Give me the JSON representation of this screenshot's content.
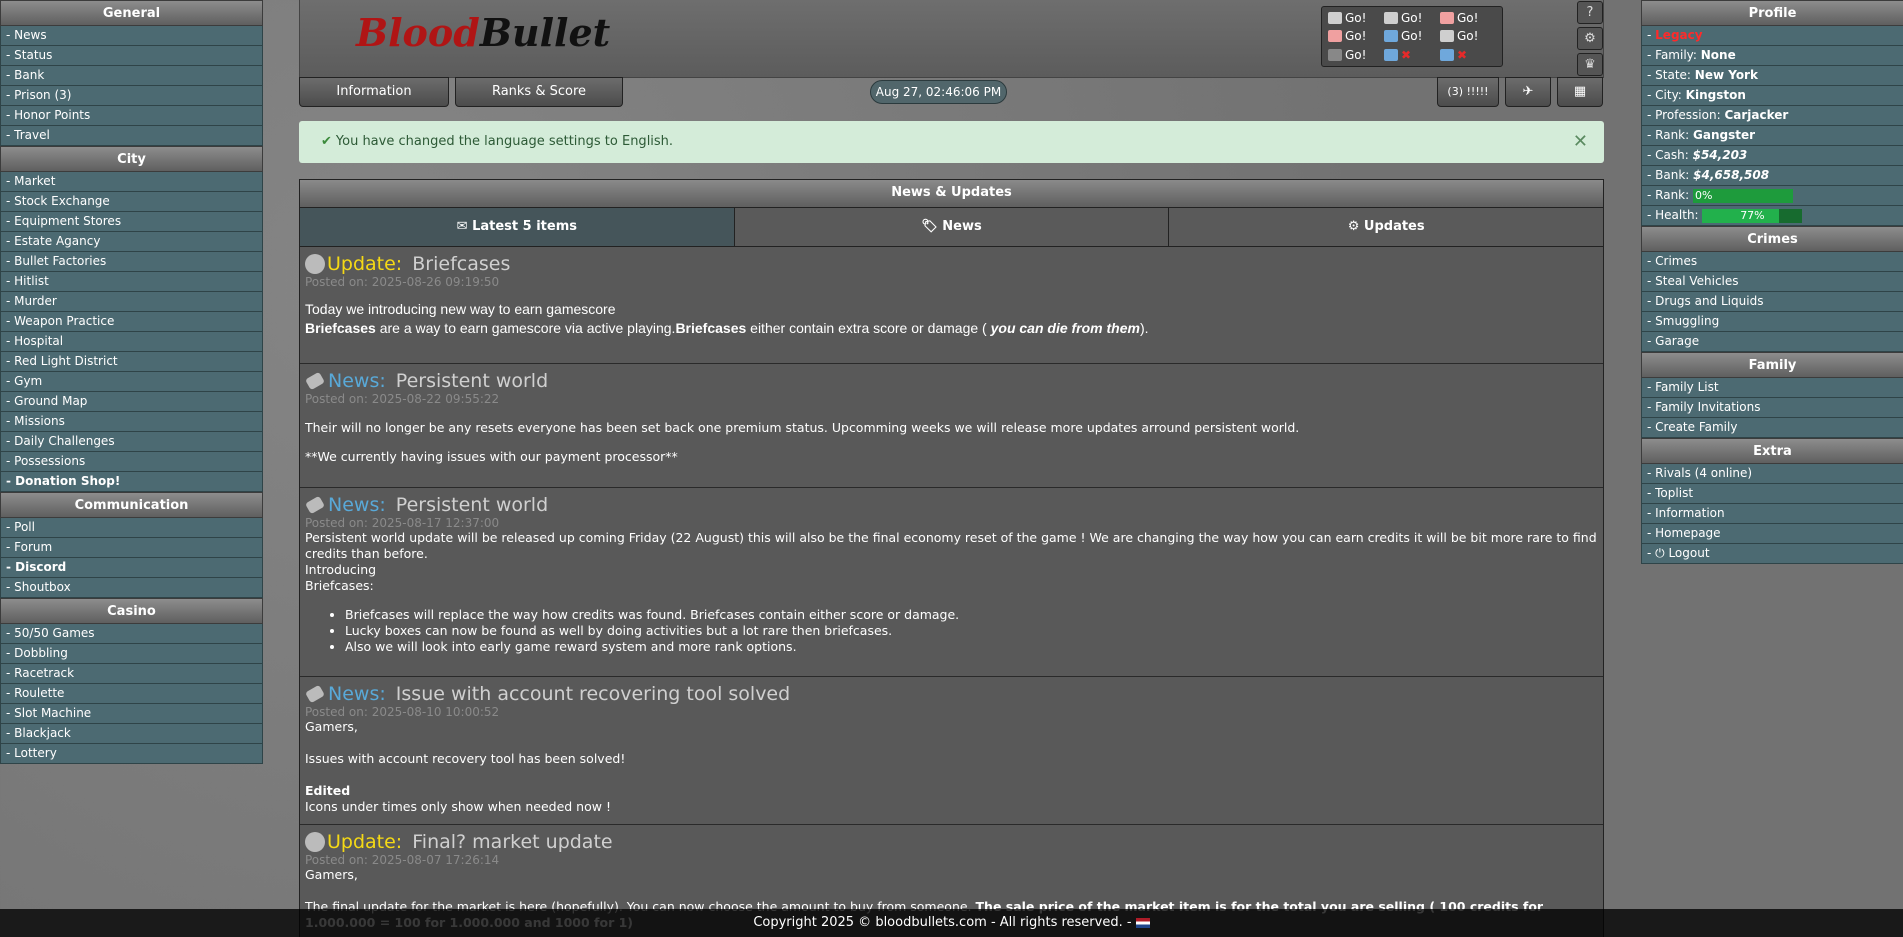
{
  "left_menu": [
    {
      "title": "General",
      "items": [
        "- News",
        "- Status",
        "- Bank",
        "- Prison (3)",
        "- Honor Points",
        "- Travel"
      ]
    },
    {
      "title": "City",
      "items": [
        "- Market",
        "- Stock Exchange",
        "- Equipment Stores",
        "- Estate Agancy",
        "- Bullet Factories",
        "- Hitlist",
        "- Murder",
        "- Weapon Practice",
        "- Hospital",
        "- Red Light District",
        "- Gym",
        "- Ground Map",
        "- Missions",
        "- Daily Challenges",
        "- Possessions",
        "- Donation Shop!"
      ]
    },
    {
      "title": "Communication",
      "items": [
        "- Poll",
        "- Forum",
        "- Discord",
        "- Shoutbox"
      ]
    },
    {
      "title": "Casino",
      "items": [
        "- 50/50 Games",
        "- Dobbling",
        "- Racetrack",
        "- Roulette",
        "- Slot Machine",
        "- Blackjack",
        "- Lottery"
      ]
    }
  ],
  "profile": {
    "title": "Profile",
    "username": "Legacy",
    "family_label": "- Family:",
    "family": "None",
    "state_label": "- State:",
    "state": "New York",
    "city_label": "- City:",
    "city": "Kingston",
    "profession_label": "- Profession:",
    "profession": "Carjacker",
    "rank_label": "- Rank:",
    "rank": "Gangster",
    "cash_label": "- Cash:",
    "cash": "$54,203",
    "bank_label": "- Bank:",
    "bank": "$4,658,508",
    "rank_progress_label": "- Rank:",
    "rank_progress": "0%",
    "rank_progress_value": 0,
    "health_label": "- Health:",
    "health": "77%",
    "health_value": 77
  },
  "right_menu": [
    {
      "title": "Crimes",
      "items": [
        "- Crimes",
        "- Steal Vehicles",
        "- Drugs and Liquids",
        "- Smuggling",
        "- Garage"
      ]
    },
    {
      "title": "Family",
      "items": [
        "- Family List",
        "- Family Invitations",
        "- Create Family"
      ]
    },
    {
      "title": "Extra",
      "items": [
        "- Rivals (4 online)",
        "- Toplist",
        "- Information",
        "- Homepage",
        "- ⏻ Logout"
      ]
    }
  ],
  "header": {
    "logo_part1": "Blood",
    "logo_part2": "Bullet",
    "quick_actions": [
      {
        "icon": "gun-icon",
        "label": "Go!",
        "color": "#cfcfcf"
      },
      {
        "icon": "gun-icon",
        "label": "Go!",
        "color": "#cfcfcf"
      },
      {
        "icon": "person-icon",
        "label": "Go!",
        "color": "#f0a0a0"
      },
      {
        "icon": "person-icon",
        "label": "Go!",
        "color": "#f0a0a0"
      },
      {
        "icon": "car-icon",
        "label": "Go!",
        "color": "#6fa8dc"
      },
      {
        "icon": "anchor-icon",
        "label": "Go!",
        "color": "#cfcfcf"
      },
      {
        "icon": "bomb-icon",
        "label": "Go!",
        "color": "#888888"
      },
      {
        "icon": "family-icon",
        "label": "✖",
        "color": "#6fa8dc"
      },
      {
        "icon": "family-icon",
        "label": "✖",
        "color": "#6fa8dc"
      }
    ],
    "side_icons": [
      "help-icon",
      "settings-icon",
      "crown-icon"
    ]
  },
  "nav": {
    "tab1": "Information",
    "tab2": "Ranks & Score",
    "clock": "Aug 27, 02:46:06 PM",
    "messages": "(3) !!!!!",
    "plane_icon": "airplane-icon",
    "map_icon": "map-icon"
  },
  "alert": {
    "text": "You have changed the language settings to English.",
    "close": "✕"
  },
  "news": {
    "header": "News & Updates",
    "tabs": [
      "Latest 5 items",
      "News",
      "Updates"
    ],
    "tab_icons": [
      "envelope-icon",
      "tag-icon",
      "gear-icon"
    ],
    "posts": [
      {
        "kind": "Update:",
        "type": "update",
        "title": "Briefcases",
        "date": "Posted on: 2025-08-26 09:19:50",
        "l1": "Today we introducing new way to earn gamescore",
        "b1": "Briefcases",
        "t1": " are a way to earn gamescore via active playing.",
        "b2": "Briefcases",
        "t2": " either contain extra score or damage ( ",
        "i1": "you can die from them",
        "t3": ")."
      },
      {
        "kind": "News:",
        "type": "news",
        "title": "Persistent world",
        "date": "Posted on: 2025-08-22 09:55:22",
        "l1": "Their will no longer be any resets everyone has been set back one premium status. Upcomming weeks we will release more updates arround persistent world.",
        "l2": "**We currently having issues with our payment processor**"
      },
      {
        "kind": "News:",
        "type": "news",
        "title": "Persistent world",
        "date": "Posted on: 2025-08-17 12:37:00",
        "l1": "Persistent world update will be released up coming Friday (22 August) this will also be the final economy reset of the game ! We are changing the way how you can earn credits it will be bit more rare to find credits than before.",
        "l2": "Introducing",
        "l3": "Briefcases:",
        "bullets": [
          "Briefcases will replace the way how credits was found. Briefcases contain either score or damage.",
          "Lucky boxes can now be found as well by doing activities but a lot rare then briefcases.",
          "Also we will look into early game reward system and more rank options."
        ]
      },
      {
        "kind": "News:",
        "type": "news",
        "title": "Issue with account recovering tool solved",
        "date": "Posted on: 2025-08-10 10:00:52",
        "l1": "Gamers,",
        "l2": "Issues with account recovery tool has been solved!",
        "l3": "Edited",
        "l4": "Icons under times only show when needed now !"
      },
      {
        "kind": "Update:",
        "type": "update",
        "title": "Final? market update",
        "date": "Posted on: 2025-08-07 17:26:14",
        "l1": "Gamers,",
        "t1": "The final update for the market is here (hopefully). You can now choose the amount to buy from someone. ",
        "b1": "The sale price of the market item is for the total you are selling ( 100 credits for 1.000.000 = 100 for 1.000.000 and 1000 for 1)"
      }
    ]
  },
  "footer": {
    "text": "Copyright 2025 © bloodbullets.com - All rights reserved. -",
    "flag": "netherlands-flag-icon"
  },
  "colors": {
    "menu_item_bg": "#4c6a72",
    "update_kind": "#f5d915",
    "news_kind": "#59a9d8",
    "alert_bg": "#d4ecd9",
    "danger": "#ff2a2a",
    "progress_green": "#1e9b3c"
  }
}
